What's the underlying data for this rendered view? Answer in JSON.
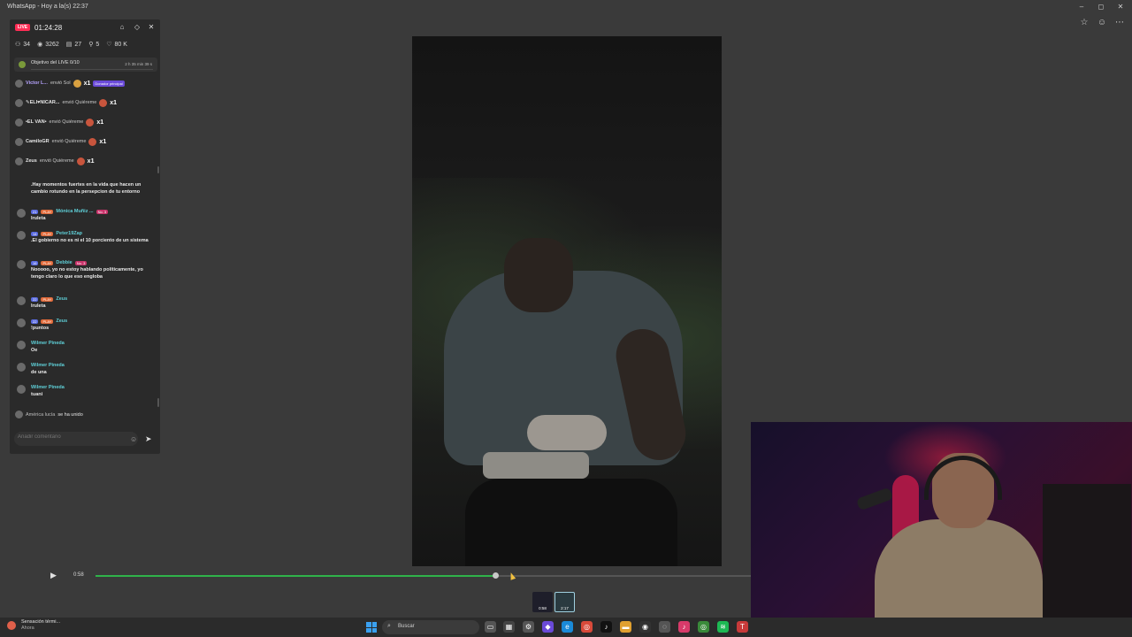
{
  "window": {
    "title": "WhatsApp - Hoy a la(s) 22:37",
    "minimize_icon": "minimize-icon",
    "maximize_icon": "maximize-icon",
    "close_icon": "close-icon"
  },
  "toolbar_right": {
    "icons": [
      "star-icon",
      "emoji-icon",
      "more-icon"
    ]
  },
  "live": {
    "badge": "LIVE",
    "elapsed": "01:24:28",
    "stats": [
      {
        "icon": "people-icon",
        "value": "34"
      },
      {
        "icon": "eye-icon",
        "value": "3262"
      },
      {
        "icon": "calendar-icon",
        "value": "27"
      },
      {
        "icon": "user-add-icon",
        "value": "5"
      },
      {
        "icon": "heart-icon",
        "value": "80 K"
      }
    ],
    "goal": {
      "label": "Objetivo del LIVE 0/10",
      "time_left": "2 h 35 min 39 s"
    },
    "gifts": [
      {
        "user": "Victor L...",
        "action": "envió Sol",
        "mult": "x1",
        "badge": "Donador principal"
      },
      {
        "user": "✎ELI♥NICAR...",
        "action": "envió Quiéreme",
        "mult": "x1",
        "badge": ""
      },
      {
        "user": "•EL VAN•",
        "action": "envió Quiéreme",
        "mult": "x1",
        "badge": ""
      },
      {
        "user": "CamiloGR",
        "action": "envió Quiéreme",
        "mult": "x1",
        "badge": ""
      },
      {
        "user": "Zeus",
        "action": "envió Quiéreme",
        "mult": "x1",
        "badge": ""
      }
    ],
    "messages": [
      {
        "level": "",
        "play": "",
        "user": "",
        "num": "",
        "text": ".Hay momentos fuertes en la vida que hacen un cambio rotundo en la persepcion de tu entorno"
      },
      {
        "level": "21",
        "play": "PLAY",
        "user": "Mónica Muñiz ...",
        "num": "No. 3",
        "text": "lruleta"
      },
      {
        "level": "14",
        "play": "PLAY",
        "user": "Peter19Zap",
        "num": "",
        "text": ".El gobierno no es ni el 10 porciento de un sistema"
      },
      {
        "level": "16",
        "play": "PLAY",
        "user": "Debbie",
        "num": "No. 3",
        "text": "Nooooo, yo no estoy hablando políticamente, yo tengo claro lo que eso engloba"
      },
      {
        "level": "22",
        "play": "PLAY",
        "user": "Zeus",
        "num": "",
        "text": "lruleta"
      },
      {
        "level": "22",
        "play": "PLAY",
        "user": "Zeus",
        "num": "",
        "text": "!puntos"
      },
      {
        "level": "",
        "play": "",
        "user": "Wilmer Pineda",
        "num": "",
        "text": "Oe"
      },
      {
        "level": "",
        "play": "",
        "user": "Wilmer Pineda",
        "num": "",
        "text": "de una"
      },
      {
        "level": "",
        "play": "",
        "user": "Wilmer Pineda",
        "num": "",
        "text": "tuani"
      }
    ],
    "joined": {
      "name": "América lucía",
      "text": "se ha unido"
    },
    "comment_placeholder": "Añadir comentario"
  },
  "player": {
    "current_time": "0:58",
    "progress": 0.61,
    "thumb_times": [
      "0:58",
      "2:17"
    ]
  },
  "taskbar": {
    "weather_title": "Sensación térmi...",
    "weather_sub": "Ahora",
    "search_label": "Buscar",
    "apps": [
      "task-view-icon",
      "file-manager-icon",
      "settings-icon",
      "copilot-icon",
      "edge-icon",
      "chrome-icon",
      "tiktok-icon",
      "folder-icon",
      "obs-icon",
      "app-icon",
      "tiktok-live-icon",
      "chrome-alt-icon",
      "spotify-icon",
      "text-icon"
    ]
  }
}
